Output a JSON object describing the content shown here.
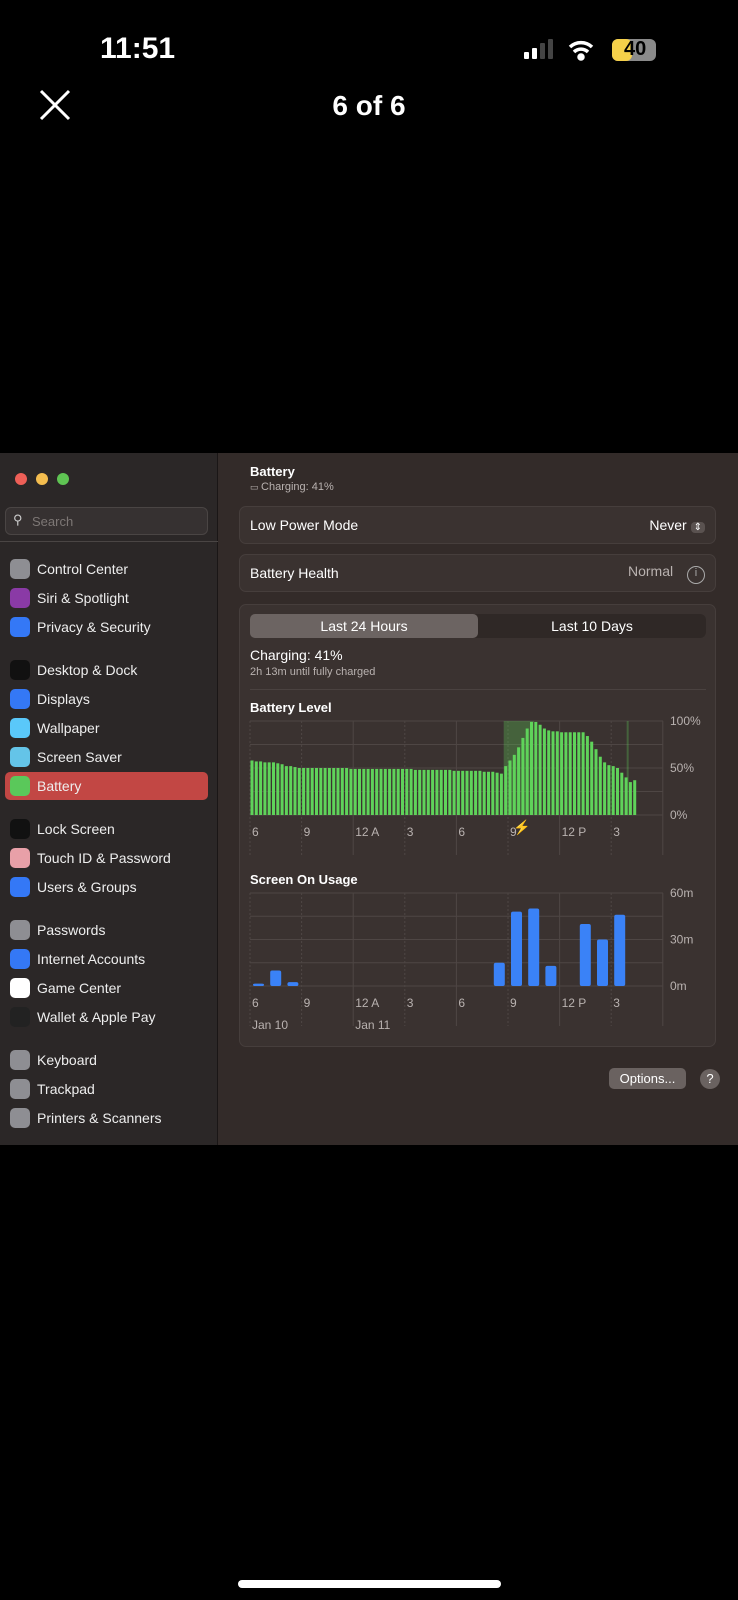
{
  "status_bar": {
    "time": "11:51",
    "battery_level": "40",
    "battery_color": "#f5d04a"
  },
  "viewer": {
    "counter": "6 of 6",
    "close_icon": "close-icon"
  },
  "sidebar": {
    "search_placeholder": "Search",
    "items": [
      {
        "label": "Control Center",
        "color": "#8e8e93"
      },
      {
        "label": "Siri & Spotlight",
        "color": "#8a3aa6"
      },
      {
        "label": "Privacy & Security",
        "color": "#3478f6"
      },
      {
        "label": "Desktop & Dock",
        "color": "#111111"
      },
      {
        "label": "Displays",
        "color": "#3478f6"
      },
      {
        "label": "Wallpaper",
        "color": "#5ac8fa"
      },
      {
        "label": "Screen Saver",
        "color": "#64c4e8"
      },
      {
        "label": "Battery",
        "color": "#5ac85a",
        "selected": true
      },
      {
        "label": "Lock Screen",
        "color": "#111111"
      },
      {
        "label": "Touch ID & Password",
        "color": "#e8a0a8"
      },
      {
        "label": "Users & Groups",
        "color": "#3478f6"
      },
      {
        "label": "Passwords",
        "color": "#8e8e93"
      },
      {
        "label": "Internet Accounts",
        "color": "#3478f6"
      },
      {
        "label": "Game Center",
        "color": "#ffffff"
      },
      {
        "label": "Wallet & Apple Pay",
        "color": "#222222"
      },
      {
        "label": "Keyboard",
        "color": "#8e8e93"
      },
      {
        "label": "Trackpad",
        "color": "#8e8e93"
      },
      {
        "label": "Printers & Scanners",
        "color": "#8e8e93"
      }
    ]
  },
  "main": {
    "title": "Battery",
    "subtitle": "Charging: 41%",
    "low_power_label": "Low Power Mode",
    "low_power_value": "Never",
    "health_label": "Battery Health",
    "health_value": "Normal",
    "tabs": [
      "Last 24 Hours",
      "Last 10 Days"
    ],
    "charging_status": "Charging: 41%",
    "charging_detail": "2h 13m until fully charged",
    "options_label": "Options...",
    "help_label": "?"
  },
  "chart_data": [
    {
      "type": "bar",
      "title": "Battery Level",
      "ylim": [
        0,
        100
      ],
      "y_ticks": [
        "100%",
        "50%",
        "0%"
      ],
      "x_ticks": [
        "6",
        "9",
        "12 A",
        "3",
        "6",
        "9",
        "12 P",
        "3"
      ],
      "interval_minutes": 15,
      "start": "6 PM Jan 10",
      "color": "#5fd35a",
      "charging_periods": [
        [
          14.75,
          16.5
        ],
        [
          21.9,
          22.0
        ]
      ],
      "values": [
        58,
        57,
        57,
        56,
        56,
        56,
        55,
        54,
        52,
        52,
        51,
        50,
        50,
        50,
        50,
        50,
        50,
        50,
        50,
        50,
        50,
        50,
        50,
        49,
        49,
        49,
        49,
        49,
        49,
        49,
        49,
        49,
        49,
        49,
        49,
        49,
        49,
        49,
        48,
        48,
        48,
        48,
        48,
        48,
        48,
        48,
        48,
        47,
        47,
        47,
        47,
        47,
        47,
        47,
        46,
        46,
        46,
        45,
        44,
        52,
        58,
        64,
        72,
        82,
        92,
        99,
        99,
        96,
        92,
        90,
        89,
        89,
        88,
        88,
        88,
        88,
        88,
        88,
        84,
        78,
        70,
        62,
        56,
        53,
        52,
        50,
        45,
        40,
        35,
        37
      ]
    },
    {
      "type": "bar",
      "title": "Screen On Usage",
      "ylim": [
        0,
        60
      ],
      "y_ticks": [
        "60m",
        "30m",
        "0m"
      ],
      "x_ticks": [
        "6",
        "9",
        "12 A",
        "3",
        "6",
        "9",
        "12 P",
        "3"
      ],
      "date_labels": [
        "Jan 10",
        "Jan 11"
      ],
      "color": "#3a82f7",
      "interval_minutes": 60,
      "values": [
        1.5,
        10,
        2.5,
        0,
        0,
        0,
        0,
        0,
        0,
        0,
        0,
        0,
        0,
        0,
        15,
        48,
        50,
        13,
        0,
        40,
        30,
        46
      ]
    }
  ]
}
